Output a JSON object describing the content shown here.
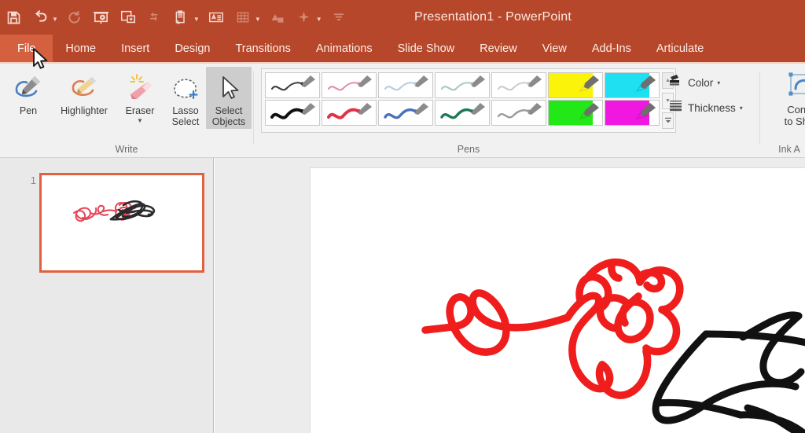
{
  "window": {
    "title": "Presentation1 - PowerPoint",
    "theme_color": "#b7472a",
    "tab_active_color": "#d4603f"
  },
  "quick_access": {
    "items": [
      {
        "name": "save-icon",
        "label": "Save",
        "has_caret": false,
        "dimmed": false
      },
      {
        "name": "undo-icon",
        "label": "Undo",
        "has_caret": true,
        "dimmed": false
      },
      {
        "name": "redo-icon",
        "label": "Redo",
        "has_caret": false,
        "dimmed": true
      },
      {
        "name": "start-from-beginning-icon",
        "label": "Start From Beginning",
        "has_caret": false,
        "dimmed": false
      },
      {
        "name": "new-slide-icon",
        "label": "New Slide",
        "has_caret": false,
        "dimmed": false
      },
      {
        "name": "spelling-icon",
        "label": "Spelling",
        "has_caret": false,
        "dimmed": true
      },
      {
        "name": "paste-icon",
        "label": "Paste",
        "has_caret": true,
        "dimmed": false
      },
      {
        "name": "text-box-icon",
        "label": "Text Box",
        "has_caret": false,
        "dimmed": false
      },
      {
        "name": "table-icon",
        "label": "Table",
        "has_caret": true,
        "dimmed": true
      },
      {
        "name": "shapes-icon",
        "label": "Shapes",
        "has_caret": false,
        "dimmed": true
      },
      {
        "name": "effects-icon",
        "label": "Effects",
        "has_caret": true,
        "dimmed": true
      },
      {
        "name": "customize-qat-icon",
        "label": "Customize Quick Access Toolbar",
        "has_caret": false,
        "dimmed": true
      }
    ]
  },
  "ribbon_tabs": [
    {
      "label": "File",
      "active": true
    },
    {
      "label": "Home",
      "active": false
    },
    {
      "label": "Insert",
      "active": false
    },
    {
      "label": "Design",
      "active": false
    },
    {
      "label": "Transitions",
      "active": false
    },
    {
      "label": "Animations",
      "active": false
    },
    {
      "label": "Slide Show",
      "active": false
    },
    {
      "label": "Review",
      "active": false
    },
    {
      "label": "View",
      "active": false
    },
    {
      "label": "Add-Ins",
      "active": false
    },
    {
      "label": "Articulate",
      "active": false
    }
  ],
  "ribbon": {
    "groups": {
      "write": {
        "label": "Write",
        "buttons": [
          {
            "name": "pen-tool",
            "label": "Pen",
            "icon": "pen-icon",
            "caret": false,
            "active": false
          },
          {
            "name": "highlighter-tool",
            "label": "Highlighter",
            "icon": "highlighter-icon",
            "caret": false,
            "active": false
          },
          {
            "name": "eraser-tool",
            "label": "Eraser",
            "icon": "eraser-icon",
            "caret": true,
            "active": false
          },
          {
            "name": "lasso-select-tool",
            "label": "Lasso Select",
            "line1": "Lasso",
            "line2": "Select",
            "icon": "lasso-select-icon",
            "caret": false,
            "active": false
          },
          {
            "name": "select-objects-tool",
            "label": "Select Objects",
            "line1": "Select",
            "line2": "Objects",
            "icon": "arrow-pointer-icon",
            "caret": false,
            "active": true
          }
        ]
      },
      "pens": {
        "label": "Pens",
        "tiles": [
          {
            "name": "pen-black-thin",
            "color": "#3d3d3d",
            "kind": "pen",
            "width": 2.2
          },
          {
            "name": "pen-pink-thin",
            "color": "#e38ea4",
            "kind": "pen",
            "width": 2.2
          },
          {
            "name": "pen-lightblue-thin",
            "color": "#b6ccdf",
            "kind": "pen",
            "width": 2.2
          },
          {
            "name": "pen-lightgreen-thin",
            "color": "#a9c9b9",
            "kind": "pen",
            "width": 2.2
          },
          {
            "name": "pen-gray-thin",
            "color": "#c9c9c9",
            "kind": "pen",
            "width": 2.2
          },
          {
            "name": "highlighter-yellow",
            "color": "#fbf40a",
            "kind": "highlighter"
          },
          {
            "name": "highlighter-cyan",
            "color": "#1fe0f0",
            "kind": "highlighter"
          },
          {
            "name": "pen-black-thick",
            "color": "#111111",
            "kind": "pen",
            "width": 4.2
          },
          {
            "name": "pen-red-thick",
            "color": "#e03247",
            "kind": "pen",
            "width": 4.2
          },
          {
            "name": "pen-blue-thick",
            "color": "#4a72b8",
            "kind": "pen",
            "width": 4.2
          },
          {
            "name": "pen-green-thick",
            "color": "#1e7a56",
            "kind": "pen",
            "width": 4.2
          },
          {
            "name": "pen-gray-thick",
            "color": "#9b9b9b",
            "kind": "pen",
            "width": 2.6
          },
          {
            "name": "highlighter-green",
            "color": "#23e817",
            "kind": "highlighter"
          },
          {
            "name": "highlighter-magenta",
            "color": "#f018e0",
            "kind": "highlighter"
          }
        ],
        "scroll": {
          "up": "▲",
          "down": "▼",
          "more": "▾"
        }
      },
      "ink_art": {
        "label": "Ink A",
        "full_label": "Ink Art",
        "color": {
          "name": "ink-color-button",
          "label": "Color",
          "caret": "▾"
        },
        "thickness": {
          "name": "ink-thickness-button",
          "label": "Thickness",
          "caret": "▾"
        },
        "convert": {
          "name": "convert-to-shapes-button",
          "line1": "Conve",
          "line2": "to Shap",
          "full_label": "Convert to Shapes"
        }
      }
    }
  },
  "workspace": {
    "thumbnail_pane": {
      "slides": [
        {
          "number": "1",
          "name": "slide-thumbnail-1",
          "selected": true
        }
      ]
    },
    "slide": {
      "name": "slide-canvas",
      "ink": {
        "red_color": "#f01d1d",
        "black_color": "#111111"
      }
    }
  }
}
